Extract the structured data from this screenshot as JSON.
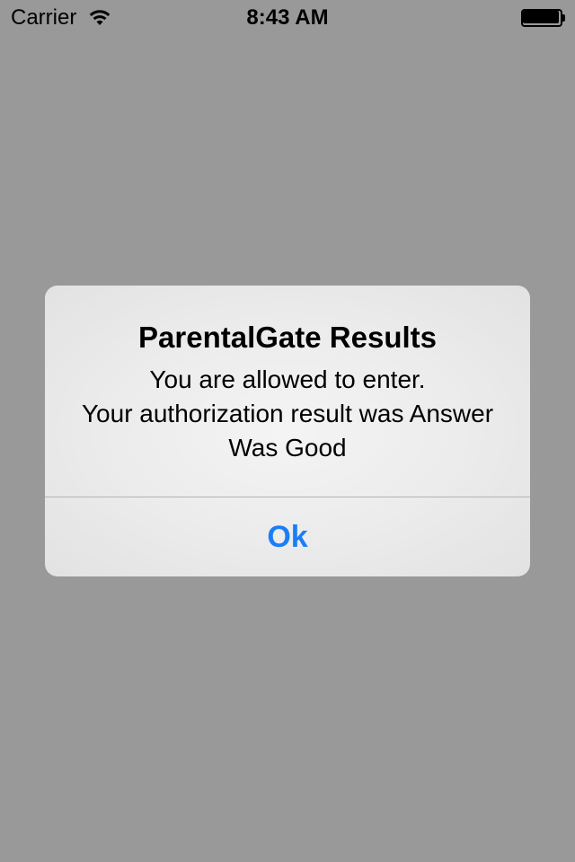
{
  "status_bar": {
    "carrier": "Carrier",
    "time": "8:43 AM",
    "wifi_icon": "wifi-icon",
    "battery_icon": "battery-full-icon"
  },
  "alert": {
    "title": "ParentalGate Results",
    "message_lines": [
      "You are allowed to enter.",
      "Your authorization result was Answer",
      "Was Good"
    ],
    "ok_label": "Ok"
  },
  "colors": {
    "background": "#999999",
    "alert_background": "#ebebeb",
    "button_accent": "#1a7ef7"
  }
}
